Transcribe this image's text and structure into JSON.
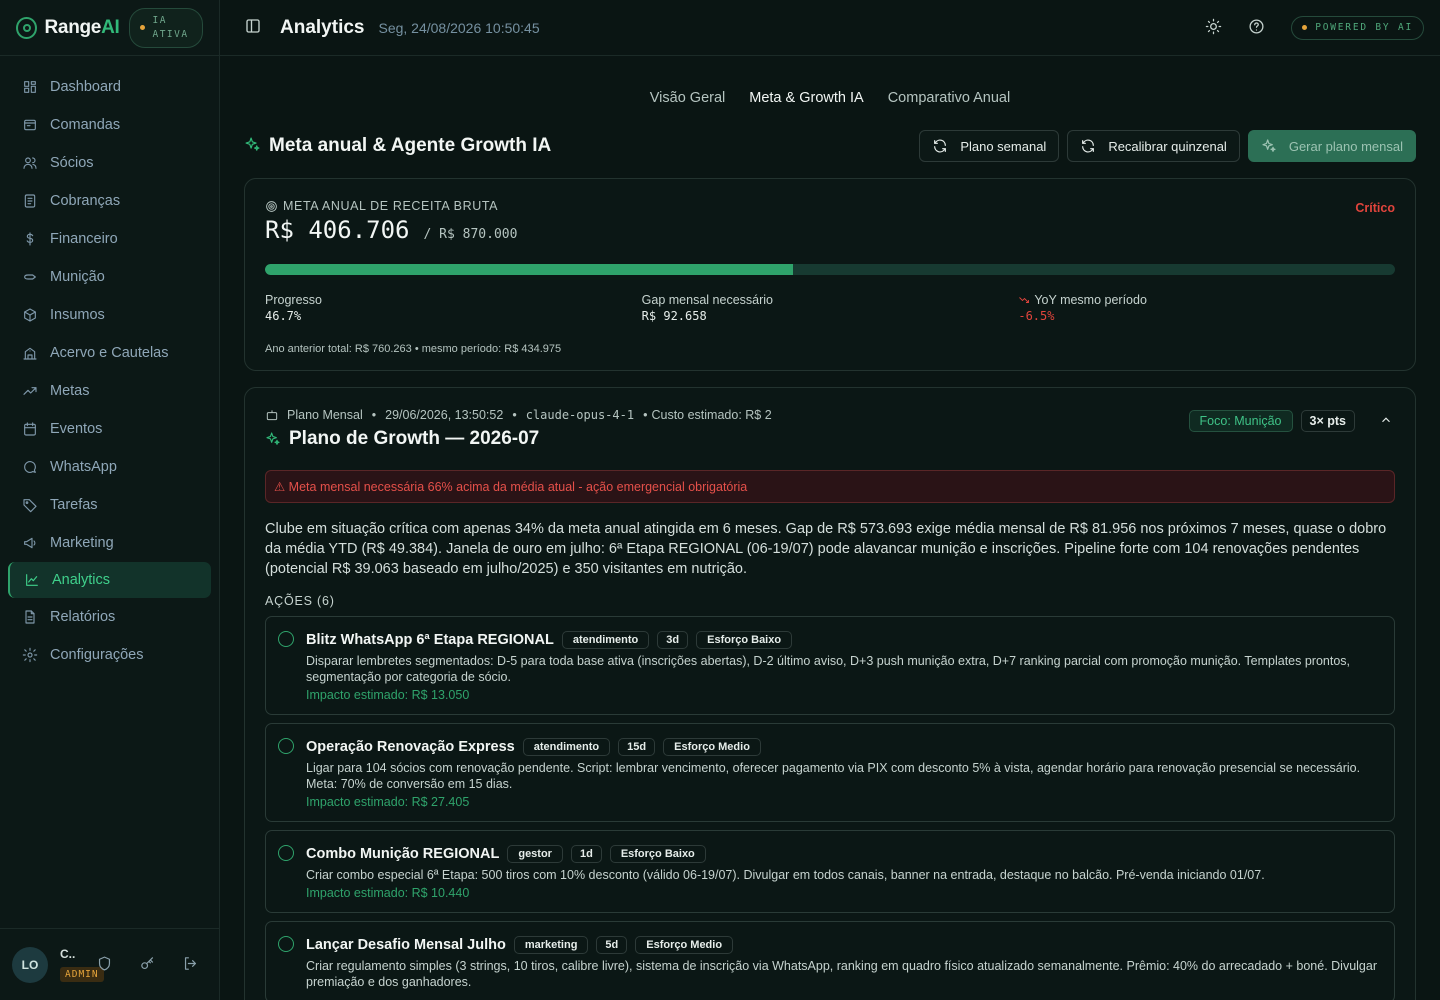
{
  "brand": {
    "name_prefix": "Range",
    "name_suffix": "AI",
    "ia_badge": "IA ATIVA"
  },
  "sidebar": {
    "items": [
      {
        "label": "Dashboard",
        "icon": "dashboard-icon"
      },
      {
        "label": "Comandas",
        "icon": "receipt-icon"
      },
      {
        "label": "Sócios",
        "icon": "users-icon"
      },
      {
        "label": "Cobranças",
        "icon": "invoice-icon"
      },
      {
        "label": "Financeiro",
        "icon": "dollar-icon"
      },
      {
        "label": "Munição",
        "icon": "ammo-icon"
      },
      {
        "label": "Insumos",
        "icon": "package-icon"
      },
      {
        "label": "Acervo e Cautelas",
        "icon": "building-icon"
      },
      {
        "label": "Metas",
        "icon": "trending-up-icon"
      },
      {
        "label": "Eventos",
        "icon": "calendar-icon"
      },
      {
        "label": "WhatsApp",
        "icon": "chat-icon"
      },
      {
        "label": "Tarefas",
        "icon": "tag-icon"
      },
      {
        "label": "Marketing",
        "icon": "megaphone-icon"
      },
      {
        "label": "Analytics",
        "icon": "chart-icon",
        "active": true
      },
      {
        "label": "Relatórios",
        "icon": "file-icon"
      },
      {
        "label": "Configurações",
        "icon": "gear-icon"
      }
    ]
  },
  "user": {
    "initials": "LO",
    "name": "C..",
    "role": "ADMIN"
  },
  "header": {
    "title": "Analytics",
    "date": "Seg, 24/08/2026 10:50:45",
    "powered": "POWERED BY AI"
  },
  "tabs": [
    {
      "label": "Visão Geral",
      "active": false
    },
    {
      "label": "Meta & Growth IA",
      "active": true
    },
    {
      "label": "Comparativo Anual",
      "active": false
    }
  ],
  "section": {
    "title": "Meta anual & Agente Growth IA",
    "buttons": {
      "weekly": "Plano semanal",
      "recalibrate": "Recalibrar quinzenal",
      "monthly": "Gerar plano mensal"
    }
  },
  "meta": {
    "label": "META ANUAL DE RECEITA BRUTA",
    "status": "Crítico",
    "value": "R$ 406.706",
    "target": "/ R$ 870.000",
    "progress_percent": 46.7,
    "stats": [
      {
        "label": "Progresso",
        "value": "46.7%"
      },
      {
        "label": "Gap mensal necessário",
        "value": "R$ 92.658"
      },
      {
        "label": "YoY mesmo período",
        "value": "-6.5%"
      }
    ],
    "footnote": "Ano anterior total: R$ 760.263 • mesmo período: R$ 434.975"
  },
  "plan": {
    "type": "Plano Mensal",
    "datetime": "29/06/2026, 13:50:52",
    "model": "claude-opus-4-1",
    "cost": "Custo estimado: R$ 2",
    "focus": "Foco: Munição",
    "points": "3× pts",
    "title": "Plano de Growth — 2026-07",
    "alert": "⚠ Meta mensal necessária 66% acima da média atual - ação emergencial obrigatória",
    "summary": "Clube em situação crítica com apenas 34% da meta anual atingida em 6 meses. Gap de R$ 573.693 exige média mensal de R$ 81.956 nos próximos 7 meses, quase o dobro da média YTD (R$ 49.384). Janela de ouro em julho: 6ª Etapa REGIONAL (06-19/07) pode alavancar munição e inscrições. Pipeline forte com 104 renovações pendentes (potencial R$ 39.063 baseado em julho/2025) e 350 visitantes em nutrição.",
    "actions_label": "AÇÕES",
    "actions_count": "(6)",
    "actions": [
      {
        "title": "Blitz WhatsApp 6ª Etapa REGIONAL",
        "owner": "atendimento",
        "duration": "3d",
        "effort": "Esforço Baixo",
        "desc": "Disparar lembretes segmentados: D-5 para toda base ativa (inscrições abertas), D-2 último aviso, D+3 push munição extra, D+7 ranking parcial com promoção munição. Templates prontos, segmentação por categoria de sócio.",
        "impact": "Impacto estimado: R$ 13.050"
      },
      {
        "title": "Operação Renovação Express",
        "owner": "atendimento",
        "duration": "15d",
        "effort": "Esforço Medio",
        "desc": "Ligar para 104 sócios com renovação pendente. Script: lembrar vencimento, oferecer pagamento via PIX com desconto 5% à vista, agendar horário para renovação presencial se necessário. Meta: 70% de conversão em 15 dias.",
        "impact": "Impacto estimado: R$ 27.405"
      },
      {
        "title": "Combo Munição REGIONAL",
        "owner": "gestor",
        "duration": "1d",
        "effort": "Esforço Baixo",
        "desc": "Criar combo especial 6ª Etapa: 500 tiros com 10% desconto (válido 06-19/07). Divulgar em todos canais, banner na entrada, destaque no balcão. Pré-venda iniciando 01/07.",
        "impact": "Impacto estimado: R$ 10.440"
      },
      {
        "title": "Lançar Desafio Mensal Julho",
        "owner": "marketing",
        "duration": "5d",
        "effort": "Esforço Medio",
        "desc": "Criar regulamento simples (3 strings, 10 tiros, calibre livre), sistema de inscrição via WhatsApp, ranking em quadro físico atualizado semanalmente. Prêmio: 40% do arrecadado + boné. Divulgar premiação e dos ganhadores.",
        "impact": ""
      }
    ]
  }
}
